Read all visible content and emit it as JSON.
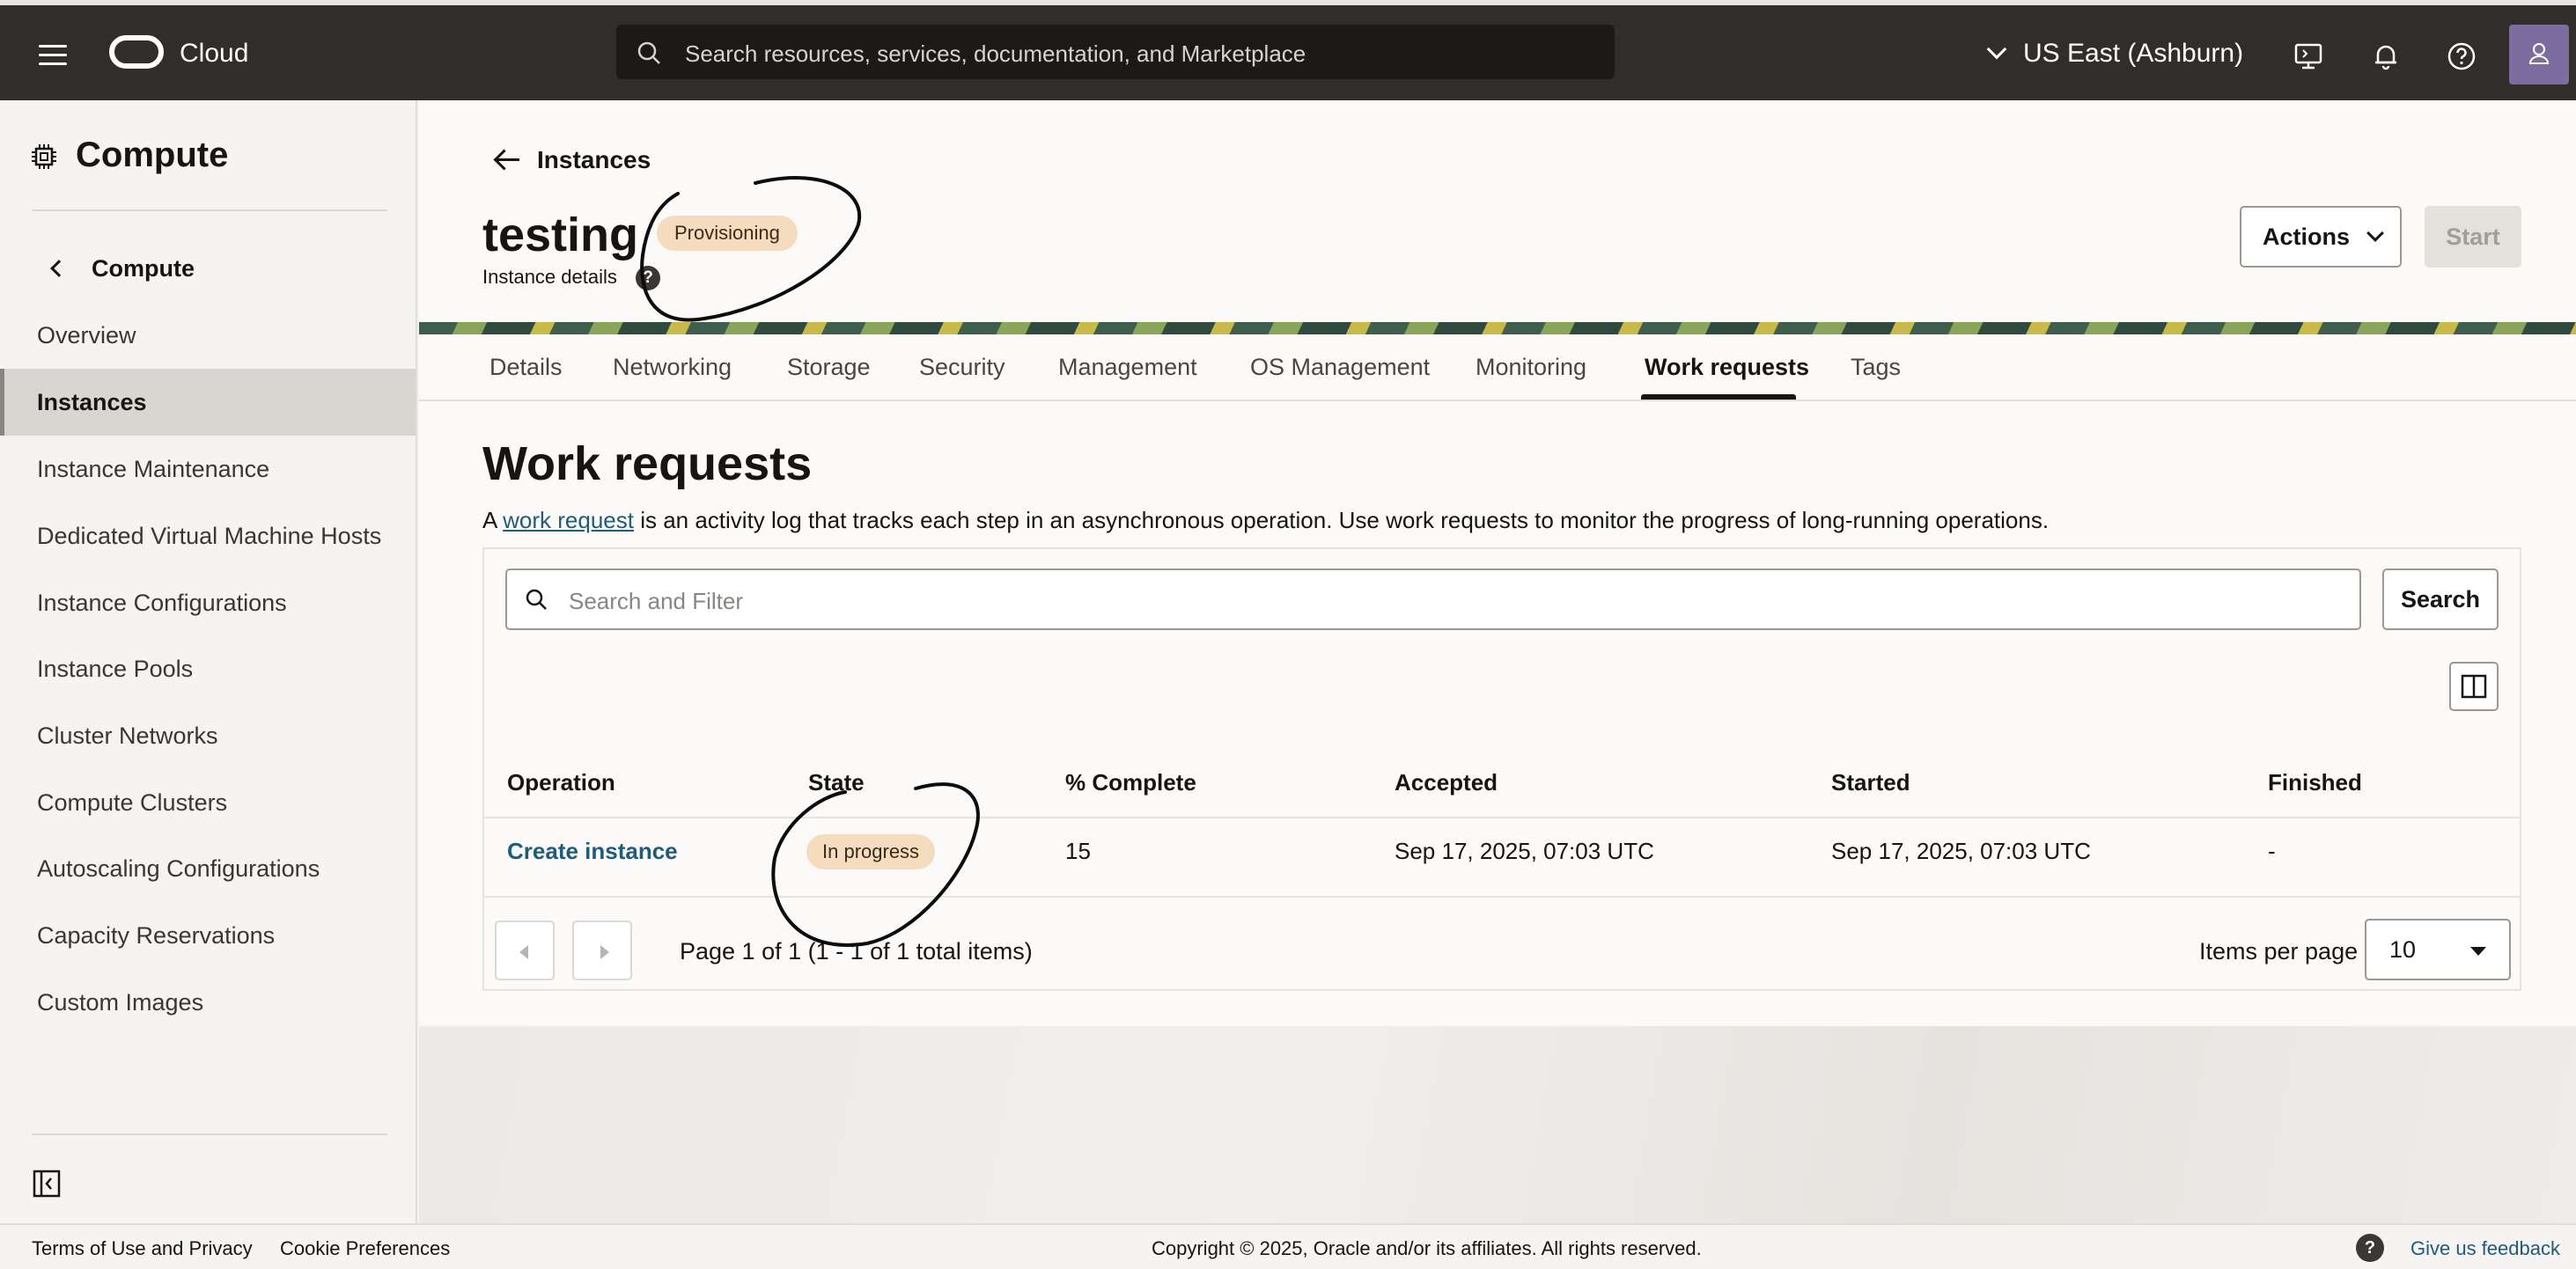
{
  "topbar": {
    "brand": "Cloud",
    "search_placeholder": "Search resources, services, documentation, and Marketplace",
    "region": "US East (Ashburn)"
  },
  "sidebar": {
    "title": "Compute",
    "back_label": "Compute",
    "items": [
      {
        "label": "Overview",
        "active": false
      },
      {
        "label": "Instances",
        "active": true
      },
      {
        "label": "Instance Maintenance",
        "active": false
      },
      {
        "label": "Dedicated Virtual Machine Hosts",
        "active": false
      },
      {
        "label": "Instance Configurations",
        "active": false
      },
      {
        "label": "Instance Pools",
        "active": false
      },
      {
        "label": "Cluster Networks",
        "active": false
      },
      {
        "label": "Compute Clusters",
        "active": false
      },
      {
        "label": "Autoscaling Configurations",
        "active": false
      },
      {
        "label": "Capacity Reservations",
        "active": false
      },
      {
        "label": "Custom Images",
        "active": false
      }
    ]
  },
  "header": {
    "back_label": "Instances",
    "title": "testing",
    "status": "Provisioning",
    "subtitle": "Instance details",
    "help_glyph": "?",
    "actions_label": "Actions",
    "start_label": "Start"
  },
  "tabs": [
    {
      "label": "Details"
    },
    {
      "label": "Networking"
    },
    {
      "label": "Storage"
    },
    {
      "label": "Security"
    },
    {
      "label": "Management"
    },
    {
      "label": "OS Management"
    },
    {
      "label": "Monitoring"
    },
    {
      "label": "Work requests",
      "active": true
    },
    {
      "label": "Tags"
    }
  ],
  "work_requests": {
    "title": "Work requests",
    "desc_prefix": "A ",
    "desc_link": "work request",
    "desc_suffix": " is an activity log that tracks each step in an asynchronous operation. Use work requests to monitor the progress of long-running operations.",
    "filter_placeholder": "Search and Filter",
    "search_label": "Search",
    "columns": [
      "Operation",
      "State",
      "% Complete",
      "Accepted",
      "Started",
      "Finished"
    ],
    "rows": [
      {
        "operation": "Create instance",
        "state": "In progress",
        "percent_complete": "15",
        "accepted": "Sep 17, 2025, 07:03 UTC",
        "started": "Sep 17, 2025, 07:03 UTC",
        "finished": "-"
      }
    ],
    "pagination_text": "Page 1 of 1 (1 - 1 of 1 total items)",
    "items_per_page_label": "Items per page",
    "items_per_page_value": "10"
  },
  "footer": {
    "terms": "Terms of Use and Privacy",
    "cookies": "Cookie Preferences",
    "copyright": "Copyright © 2025, Oracle and/or its affiliates. All rights reserved.",
    "help_glyph": "?",
    "feedback": "Give us feedback"
  },
  "colors": {
    "topbar_bg": "#312d2a",
    "badge_bg": "#f5dcbf",
    "link": "#1f5c7a"
  }
}
